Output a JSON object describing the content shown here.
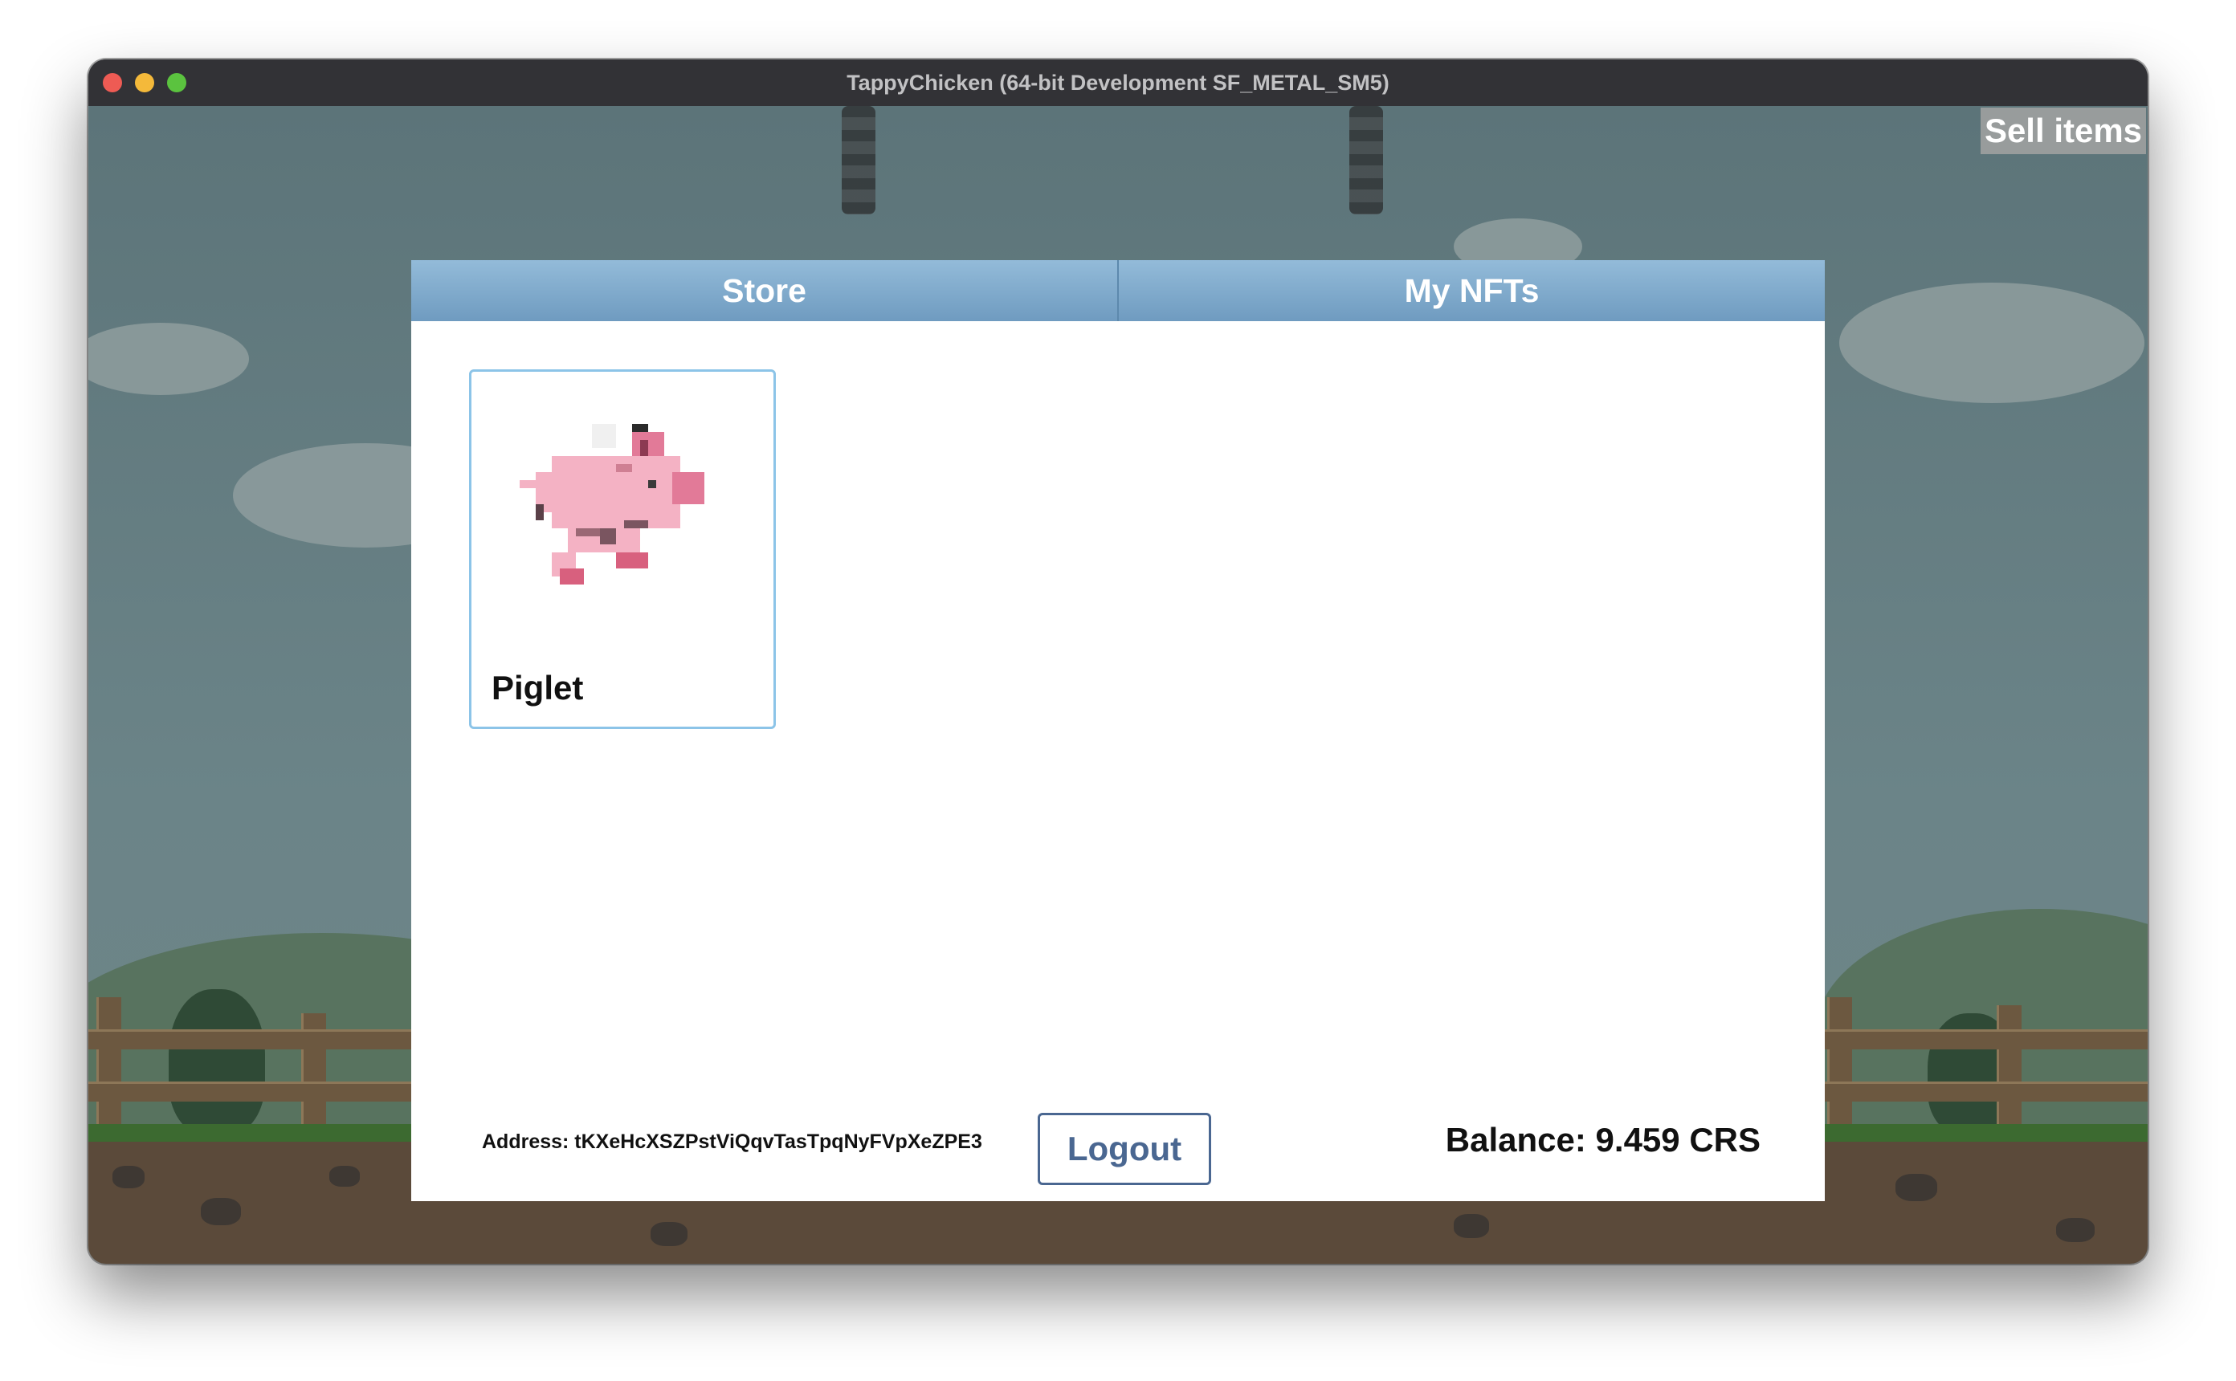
{
  "window": {
    "title": "TappyChicken (64-bit Development SF_METAL_SM5)"
  },
  "toolbar": {
    "sell_label": "Sell items"
  },
  "tabs": [
    {
      "label": "Store"
    },
    {
      "label": "My NFTs"
    }
  ],
  "items": [
    {
      "name": "Piglet",
      "icon": "pixel-pig-icon"
    }
  ],
  "footer": {
    "address": "Address: tKXeHcXSZPstViQqvTasTpqNyFVpXeZPE3",
    "logout_label": "Logout",
    "balance": "Balance: 9.459 CRS"
  },
  "colors": {
    "tab_bar": "#7fa8cc",
    "card_border": "#8cc4e8",
    "logout_accent": "#4a6791"
  }
}
